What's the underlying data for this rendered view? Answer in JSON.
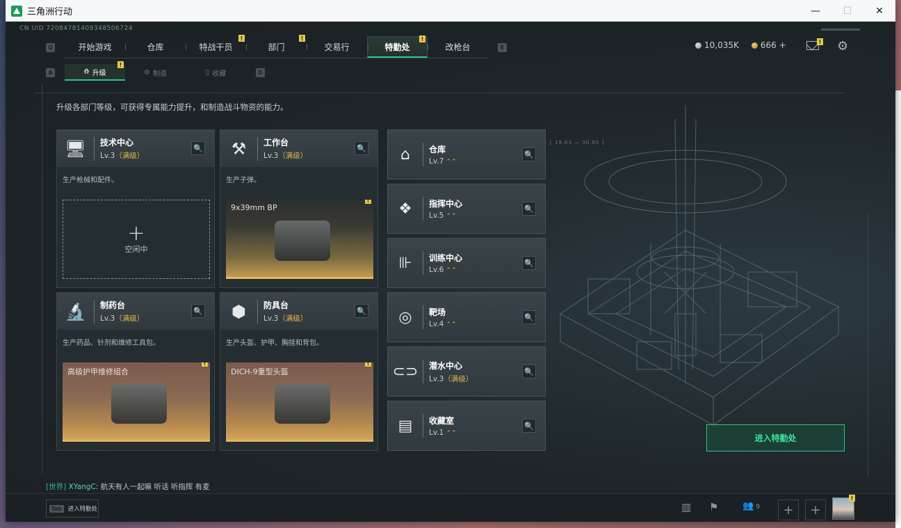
{
  "window": {
    "title": "三角洲行动",
    "controls": {
      "minimize": "—",
      "maximize": "☐",
      "close": "✕"
    }
  },
  "uid": "CN UID 72084781409348506724",
  "top_nav": {
    "left_key": "Q",
    "right_key": "E",
    "tabs": [
      {
        "label": "开始游戏",
        "badge": ""
      },
      {
        "label": "仓库",
        "badge": ""
      },
      {
        "label": "特战干员",
        "badge": "!"
      },
      {
        "label": "部门",
        "badge": "!"
      },
      {
        "label": "交易行",
        "badge": ""
      },
      {
        "label": "特勤处",
        "badge": "!",
        "active": true
      },
      {
        "label": "改枪台",
        "badge": ""
      }
    ]
  },
  "currency": {
    "silver": "10,035K",
    "gold": "666 +"
  },
  "mail_badge": "!",
  "sub_nav": {
    "left_key": "A",
    "right_key": "D",
    "tabs": [
      {
        "label": "升级",
        "icon": "upgrade-icon",
        "badge": "!",
        "active": true
      },
      {
        "label": "制造",
        "icon": "craft-icon",
        "badge": ""
      },
      {
        "label": "收藏",
        "icon": "collection-icon",
        "badge": ""
      }
    ]
  },
  "description": "升级各部门等级，可获得专属能力提升，和制造战斗物资的能力。",
  "cards": [
    {
      "title": "技术中心",
      "level": "Lv.3",
      "max": "（满级）",
      "desc": "生产枪械和配件。",
      "icon": "tech-center-icon",
      "status": "idle",
      "idle_label": "空闲中",
      "plus": "+"
    },
    {
      "title": "工作台",
      "level": "Lv.3",
      "max": "（满级）",
      "desc": "生产子弹。",
      "icon": "workbench-icon",
      "status": "item",
      "item": "9x39mm BP",
      "badge": "!"
    },
    {
      "title": "制药台",
      "level": "Lv.3",
      "max": "（满级）",
      "desc": "生产药品、针剂和维修工具包。",
      "icon": "pharmacy-icon",
      "status": "item",
      "item": "高级护甲维修组合",
      "badge": "!"
    },
    {
      "title": "防具台",
      "level": "Lv.3",
      "max": "（满级）",
      "desc": "生产头盔、护甲、胸挂和背包。",
      "icon": "armor-bench-icon",
      "status": "item",
      "item": "DICH-9重型头盔",
      "badge": "!"
    }
  ],
  "tiles": [
    {
      "title": "仓库",
      "level": "Lv.7",
      "max": "",
      "icon": "warehouse-icon",
      "up": "⌃⌃"
    },
    {
      "title": "指挥中心",
      "level": "Lv.5",
      "max": "",
      "icon": "command-center-icon",
      "up": "⌃⌃"
    },
    {
      "title": "训练中心",
      "level": "Lv.6",
      "max": "",
      "icon": "training-center-icon",
      "up": "⌃⌃"
    },
    {
      "title": "靶场",
      "level": "Lv.4",
      "max": "",
      "icon": "shooting-range-icon",
      "up": "⌃⌃"
    },
    {
      "title": "潜水中心",
      "level": "Lv.3",
      "max": "（满级）",
      "icon": "diving-center-icon",
      "up": ""
    },
    {
      "title": "收藏室",
      "level": "Lv.1",
      "max": "",
      "icon": "collection-room-icon",
      "up": "⌃⌃"
    }
  ],
  "coord_text": "[ 19.03 — 30.85 ]",
  "enter_button": "进入特勤处",
  "chat": {
    "channel": "[世界]",
    "name": "XYangC",
    "message": ": 航天有人一起嘛 听话 听指挥 有麦"
  },
  "bottom": {
    "tab_key": "Tab",
    "tab_label": "进入特勤处",
    "friends_count": "9",
    "avatar_badge": "!"
  },
  "colors": {
    "accent": "#22c88a",
    "badge": "#e7c84a",
    "max_level": "#e3b64a"
  }
}
